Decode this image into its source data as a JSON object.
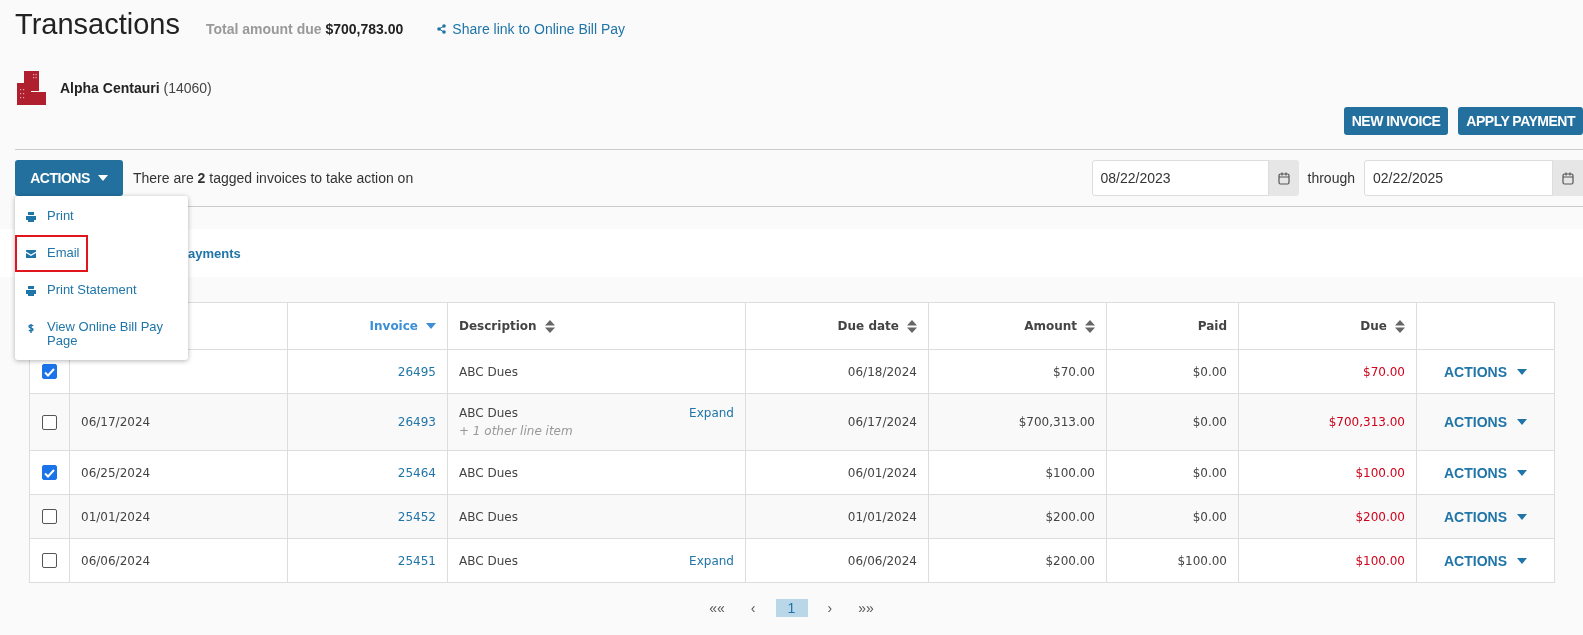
{
  "header": {
    "title": "Transactions",
    "total_label": "Total amount due",
    "total_value": "$700,783.00",
    "share_link": "Share link to Online Bill Pay"
  },
  "account": {
    "name": "Alpha Centauri",
    "number": "(14060)"
  },
  "buttons": [
    "NEW INVOICE",
    "APPLY PAYMENT"
  ],
  "actions_bar": {
    "button": "ACTIONS",
    "message": "There are **2** tagged invoices to take action on",
    "date_from": "08/22/2023",
    "through": "through",
    "date_to": "02/22/2025"
  },
  "actions_menu": [
    {
      "label": "Print",
      "kind": "print",
      "highlighted": false
    },
    {
      "label": "Email",
      "kind": "mail",
      "highlighted": true
    },
    {
      "label": "Print Statement",
      "kind": "print",
      "highlighted": false
    },
    {
      "label": "View Online Bill Pay Page",
      "kind": "dollar",
      "highlighted": false
    }
  ],
  "tab": "ayments",
  "table": {
    "columns": [
      {
        "label": "Invoice",
        "kind": "sorted"
      },
      {
        "label": "Description",
        "kind": "sortable"
      },
      {
        "label": "Due date",
        "kind": "sortable"
      },
      {
        "label": "Amount",
        "kind": "sortable"
      },
      {
        "label": "Paid",
        "kind": "plain"
      },
      {
        "label": "Due",
        "kind": "sortable"
      }
    ],
    "rows": [
      {
        "checked": true,
        "invoice": "26495",
        "description": "ABC Dues",
        "due_date": "06/18/2024",
        "amount": "$70.00",
        "paid": "$0.00",
        "due": "$70.00",
        "action": "ACTIONS"
      },
      {
        "checked": false,
        "date": "06/17/2024",
        "invoice": "26493",
        "description": "ABC Dues",
        "extra": "+ 1 other line item",
        "expand": "Expand",
        "due_date": "06/17/2024",
        "amount": "$700,313.00",
        "paid": "$0.00",
        "due": "$700,313.00",
        "action": "ACTIONS"
      },
      {
        "checked": true,
        "date": "06/25/2024",
        "invoice": "25464",
        "description": "ABC Dues",
        "due_date": "06/01/2024",
        "amount": "$100.00",
        "paid": "$0.00",
        "due": "$100.00",
        "action": "ACTIONS"
      },
      {
        "checked": false,
        "date": "01/01/2024",
        "invoice": "25452",
        "description": "ABC Dues",
        "due_date": "01/01/2024",
        "amount": "$200.00",
        "paid": "$0.00",
        "due": "$200.00",
        "action": "ACTIONS"
      },
      {
        "checked": false,
        "date": "06/06/2024",
        "invoice": "25451",
        "description": "ABC Dues",
        "expand": "Expand",
        "due_date": "06/06/2024",
        "amount": "$200.00",
        "paid": "$100.00",
        "due": "$100.00",
        "action": "ACTIONS"
      }
    ]
  },
  "pagination": [
    {
      "label": "««",
      "selected": false
    },
    {
      "label": "‹",
      "selected": false
    },
    {
      "label": "1",
      "selected": true
    },
    {
      "label": "›",
      "selected": false
    },
    {
      "label": "»»",
      "selected": false
    }
  ]
}
